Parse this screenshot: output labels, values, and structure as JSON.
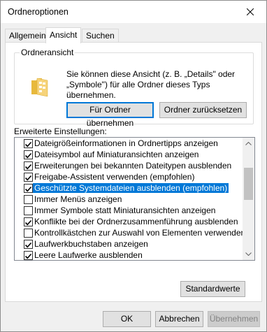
{
  "window": {
    "title": "Ordneroptionen"
  },
  "tabs": [
    {
      "label": "Allgemein",
      "active": false
    },
    {
      "label": "Ansicht",
      "active": true
    },
    {
      "label": "Suchen",
      "active": false
    }
  ],
  "folder_view": {
    "group_label": "Ordneransicht",
    "description": "Sie können diese Ansicht (z. B. „Details\" oder „Symbole\") für alle Ordner dieses Typs übernehmen.",
    "apply_button": "Für Ordner übernehmen",
    "reset_button": "Ordner zurücksetzen"
  },
  "advanced": {
    "label": "Erweiterte Einstellungen:",
    "items": [
      {
        "label": "Dateigrößeinformationen in Ordnertipps anzeigen",
        "checked": true,
        "selected": false
      },
      {
        "label": "Dateisymbol auf Miniaturansichten anzeigen",
        "checked": true,
        "selected": false
      },
      {
        "label": "Erweiterungen bei bekannten Dateitypen ausblenden",
        "checked": true,
        "selected": false
      },
      {
        "label": "Freigabe-Assistent verwenden (empfohlen)",
        "checked": true,
        "selected": false
      },
      {
        "label": "Geschützte Systemdateien ausblenden (empfohlen)",
        "checked": true,
        "selected": true
      },
      {
        "label": "Immer Menüs anzeigen",
        "checked": false,
        "selected": false
      },
      {
        "label": "Immer Symbole statt Miniaturansichten anzeigen",
        "checked": false,
        "selected": false
      },
      {
        "label": "Konflikte bei der Ordnerzusammenführung ausblenden",
        "checked": true,
        "selected": false
      },
      {
        "label": "Kontrollkästchen zur Auswahl von Elementen verwenden",
        "checked": false,
        "selected": false
      },
      {
        "label": "Laufwerkbuchstaben anzeigen",
        "checked": true,
        "selected": false
      },
      {
        "label": "Leere Laufwerke ausblenden",
        "checked": true,
        "selected": false
      }
    ],
    "defaults_button": "Standardwerte"
  },
  "footer": {
    "ok": "OK",
    "cancel": "Abbrechen",
    "apply": "Übernehmen"
  }
}
